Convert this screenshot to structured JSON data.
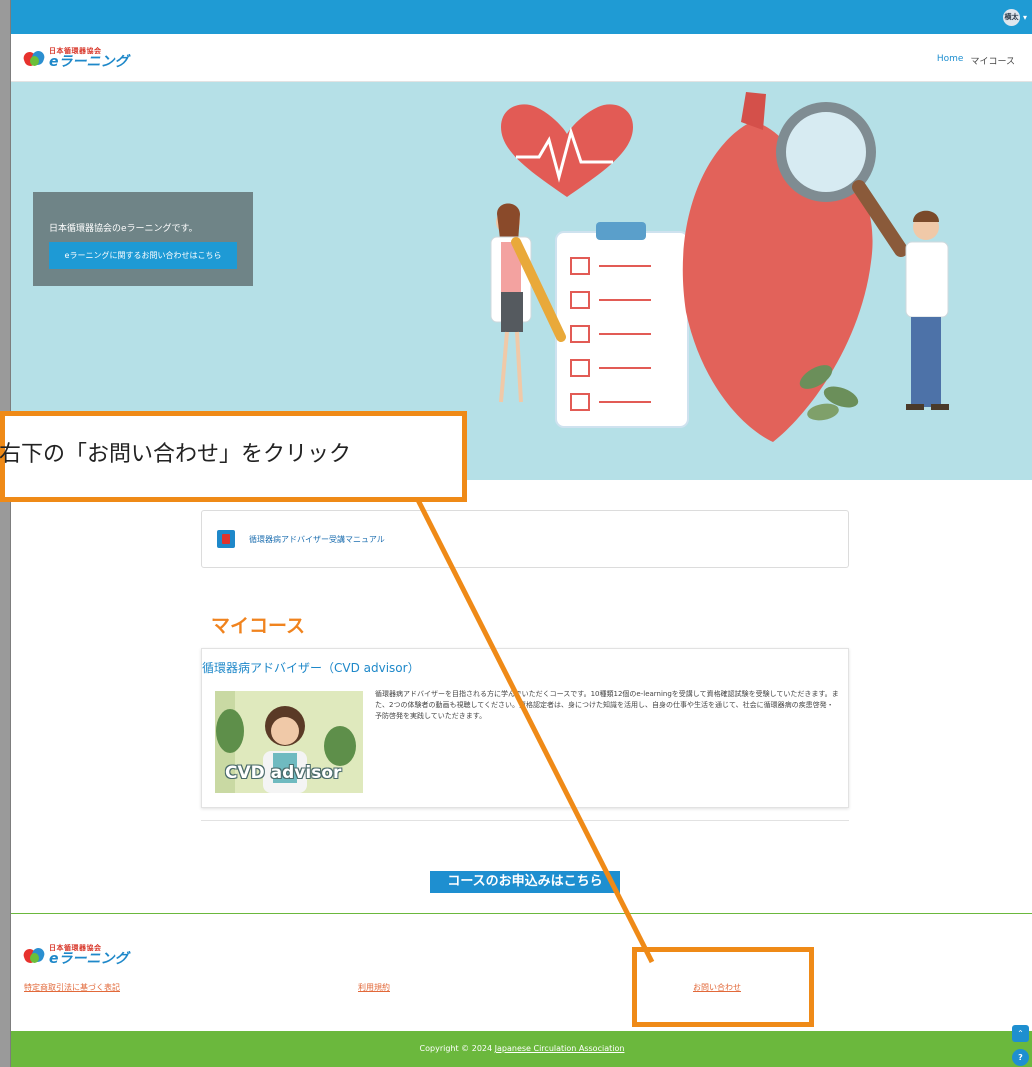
{
  "topbar": {
    "user_initials": "横太",
    "caret": "▾"
  },
  "header": {
    "logo_org": "日本循環器協会",
    "logo_name": "eラーニング",
    "nav": {
      "home": "Home",
      "mycourse": "マイコース"
    }
  },
  "hero": {
    "welcome_text": "日本循環器協会のeラーニングです。",
    "contact_button": "eラーニングに関するお問い合わせはこちら"
  },
  "manual": {
    "title": "循環器病アドバイザー受講マニュアル"
  },
  "mycourse": {
    "section_title": "マイコース",
    "course_title": "循環器病アドバイザー（CVD advisor）",
    "thumb_text": "CVD advisor",
    "description": "循環器病アドバイザーを目指される方に学んでいただくコースです。10種類12個のe-learningを受講して資格確認試験を受験していただきます。また、2つの体験者の動画も視聴してください。資格認定者は、身につけた知識を活用し、自身の仕事や生活を通じて、社会に循環器病の疾患啓発・予防啓発を実践していただきます。"
  },
  "apply_button": "コースのお申込みはこちら",
  "footer": {
    "logo_org": "日本循環器協会",
    "logo_name": "eラーニング",
    "links": {
      "commerce": "特定商取引法に基づく表記",
      "terms": "利用規約",
      "contact": "お問い合わせ"
    },
    "copyright_prefix": "Copyright © 2024 ",
    "copyright_link": "Japanese Circulation Association"
  },
  "side_buttons": {
    "scroll_up": "⌃",
    "help": "?"
  },
  "annotation": {
    "callout_text": "右下の「お問い合わせ」をクリック"
  },
  "colors": {
    "topbar": "#1f9bd4",
    "hero_bg": "#b5e0e7",
    "accent_orange": "#f0831e",
    "annotation_orange": "#ef8a17",
    "footer_green": "#6bb83d",
    "link_blue": "#1e88c9"
  }
}
